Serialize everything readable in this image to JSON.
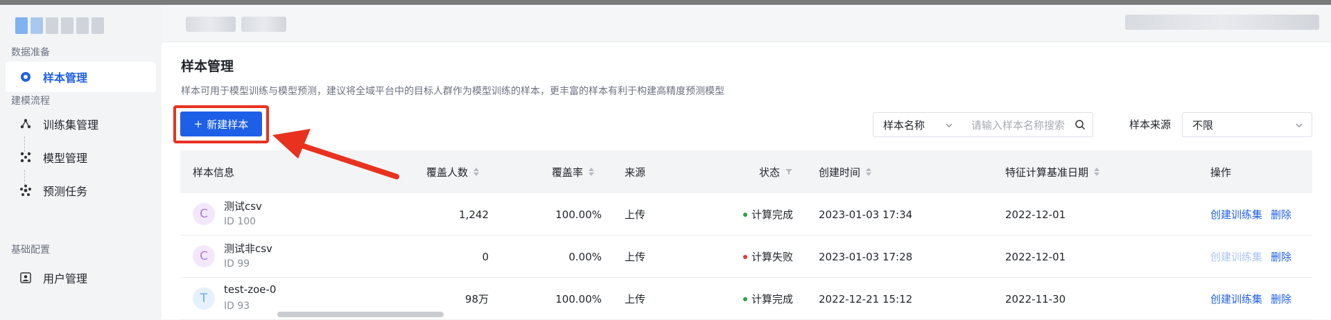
{
  "sidebar": {
    "groups": [
      {
        "title": "数据准备"
      },
      {
        "title": "建模流程"
      },
      {
        "title": "基础配置"
      }
    ],
    "items": [
      {
        "label": "样本管理",
        "icon": "sample-icon",
        "active": true
      },
      {
        "label": "训练集管理",
        "icon": "training-set-icon"
      },
      {
        "label": "模型管理",
        "icon": "model-icon"
      },
      {
        "label": "预测任务",
        "icon": "prediction-icon"
      },
      {
        "label": "用户管理",
        "icon": "user-icon"
      }
    ]
  },
  "page": {
    "title": "样本管理",
    "description": "样本可用于模型训练与模型预测，建议将全域平台中的目标人群作为模型训练的样本，更丰富的样本有利于构建高精度预测模型",
    "new_button": "新建样本",
    "new_button_icon": "+"
  },
  "filters": {
    "field_select": "样本名称",
    "search_placeholder": "请输入样本名称搜索",
    "source_label": "样本来源",
    "source_value": "不限"
  },
  "table": {
    "columns": [
      "样本信息",
      "覆盖人数",
      "覆盖率",
      "来源",
      "状态",
      "创建时间",
      "特征计算基准日期",
      "操作"
    ],
    "rows": [
      {
        "avatar": "C",
        "name": "测试csv",
        "id": "ID 100",
        "coverage": "1,242",
        "rate": "100.00%",
        "source": "上传",
        "status": "计算完成",
        "status_color": "#2ea043",
        "created": "2023-01-03 17:34",
        "base_date": "2022-12-01",
        "action1": "创建训练集",
        "action1_disabled": false,
        "action2": "删除"
      },
      {
        "avatar": "C",
        "name": "测试非csv",
        "id": "ID 99",
        "coverage": "0",
        "rate": "0.00%",
        "source": "上传",
        "status": "计算失败",
        "status_color": "#e5383b",
        "created": "2023-01-03 17:28",
        "base_date": "2022-12-01",
        "action1": "创建训练集",
        "action1_disabled": true,
        "action2": "删除"
      },
      {
        "avatar": "T",
        "name": "test-zoe-0",
        "id": "ID 93",
        "coverage": "98万",
        "rate": "100.00%",
        "source": "上传",
        "status": "计算完成",
        "status_color": "#2ea043",
        "created": "2022-12-21 15:12",
        "base_date": "2022-11-30",
        "action1": "创建训练集",
        "action1_disabled": false,
        "action2": "删除"
      }
    ]
  },
  "colors": {
    "primary": "#1e5fe8",
    "highlight": "#e8321f"
  }
}
